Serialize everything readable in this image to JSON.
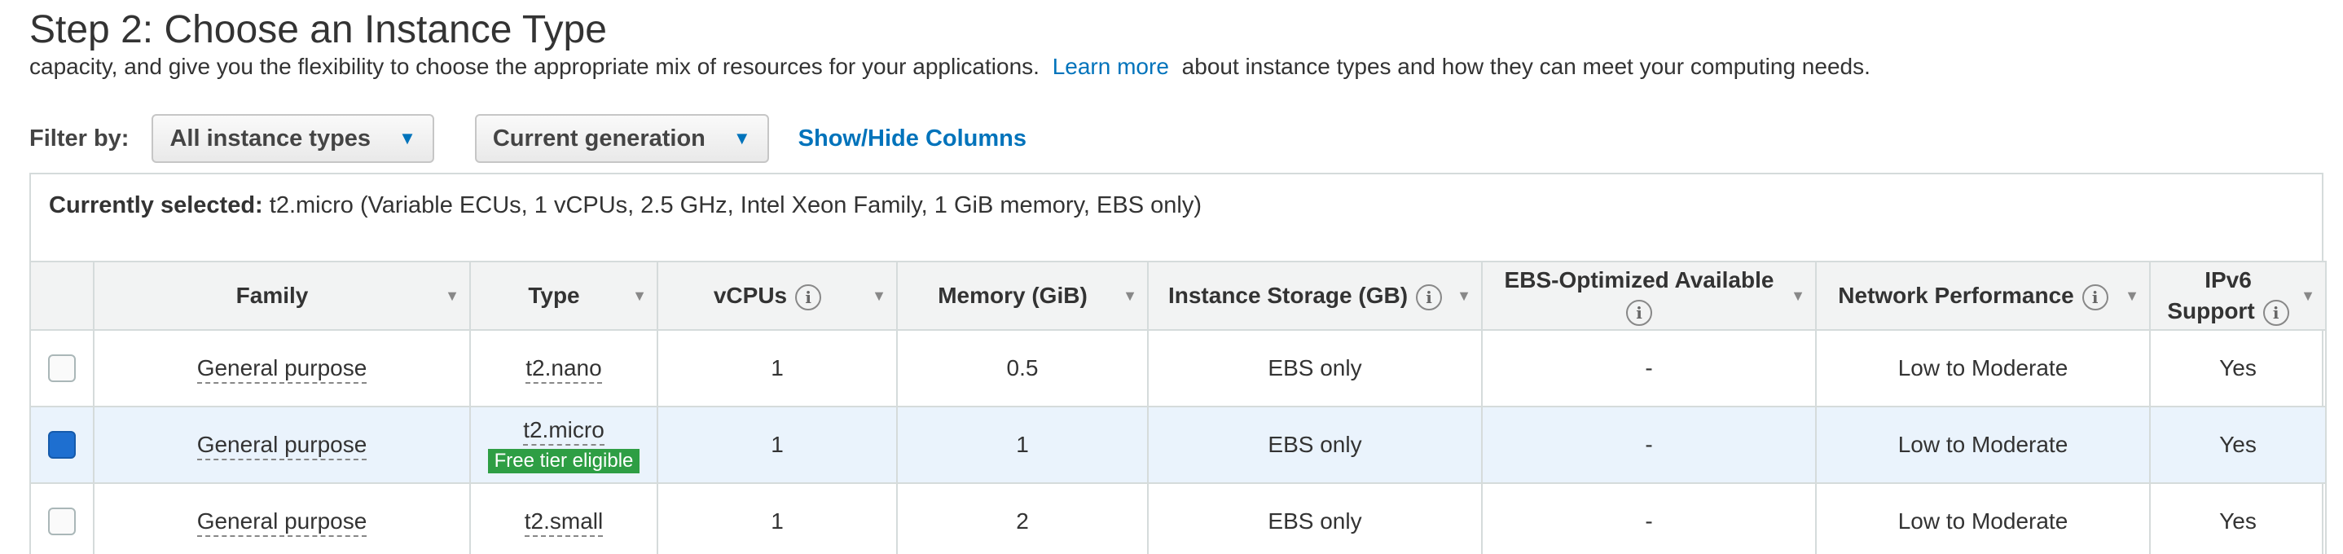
{
  "title": "Step 2: Choose an Instance Type",
  "intro": {
    "before": "capacity, and give you the flexibility to choose the appropriate mix of resources for your applications.",
    "link": "Learn more",
    "after": "about instance types and how they can meet your computing needs."
  },
  "filter": {
    "label": "Filter by:",
    "instance_types": "All instance types",
    "generation": "Current generation",
    "show_hide": "Show/Hide Columns"
  },
  "selection": {
    "label": "Currently selected:",
    "value": "t2.micro (Variable ECUs, 1 vCPUs, 2.5 GHz, Intel Xeon Family, 1 GiB memory, EBS only)"
  },
  "columns": {
    "family": "Family",
    "type": "Type",
    "vcpus": "vCPUs",
    "memory": "Memory (GiB)",
    "storage": "Instance Storage (GB)",
    "ebs_line1": "EBS-Optimized Available",
    "network": "Network Performance",
    "ipv6_line1": "IPv6",
    "ipv6_line2": "Support"
  },
  "rows": [
    {
      "selected": false,
      "family": "General purpose",
      "type": "t2.nano",
      "badge": "",
      "vcpus": "1",
      "memory": "0.5",
      "storage": "EBS only",
      "ebs": "-",
      "network": "Low to Moderate",
      "ipv6": "Yes"
    },
    {
      "selected": true,
      "family": "General purpose",
      "type": "t2.micro",
      "badge": "Free tier eligible",
      "vcpus": "1",
      "memory": "1",
      "storage": "EBS only",
      "ebs": "-",
      "network": "Low to Moderate",
      "ipv6": "Yes"
    },
    {
      "selected": false,
      "family": "General purpose",
      "type": "t2.small",
      "badge": "",
      "vcpus": "1",
      "memory": "2",
      "storage": "EBS only",
      "ebs": "-",
      "network": "Low to Moderate",
      "ipv6": "Yes"
    }
  ],
  "icons": {
    "info": "i",
    "sort": "▾",
    "dropdown": "⌄"
  },
  "colors": {
    "link": "#0073bb",
    "badge": "#2e9e44",
    "selected_row": "#eaf3fc",
    "checkbox_checked": "#1e6fd0"
  }
}
